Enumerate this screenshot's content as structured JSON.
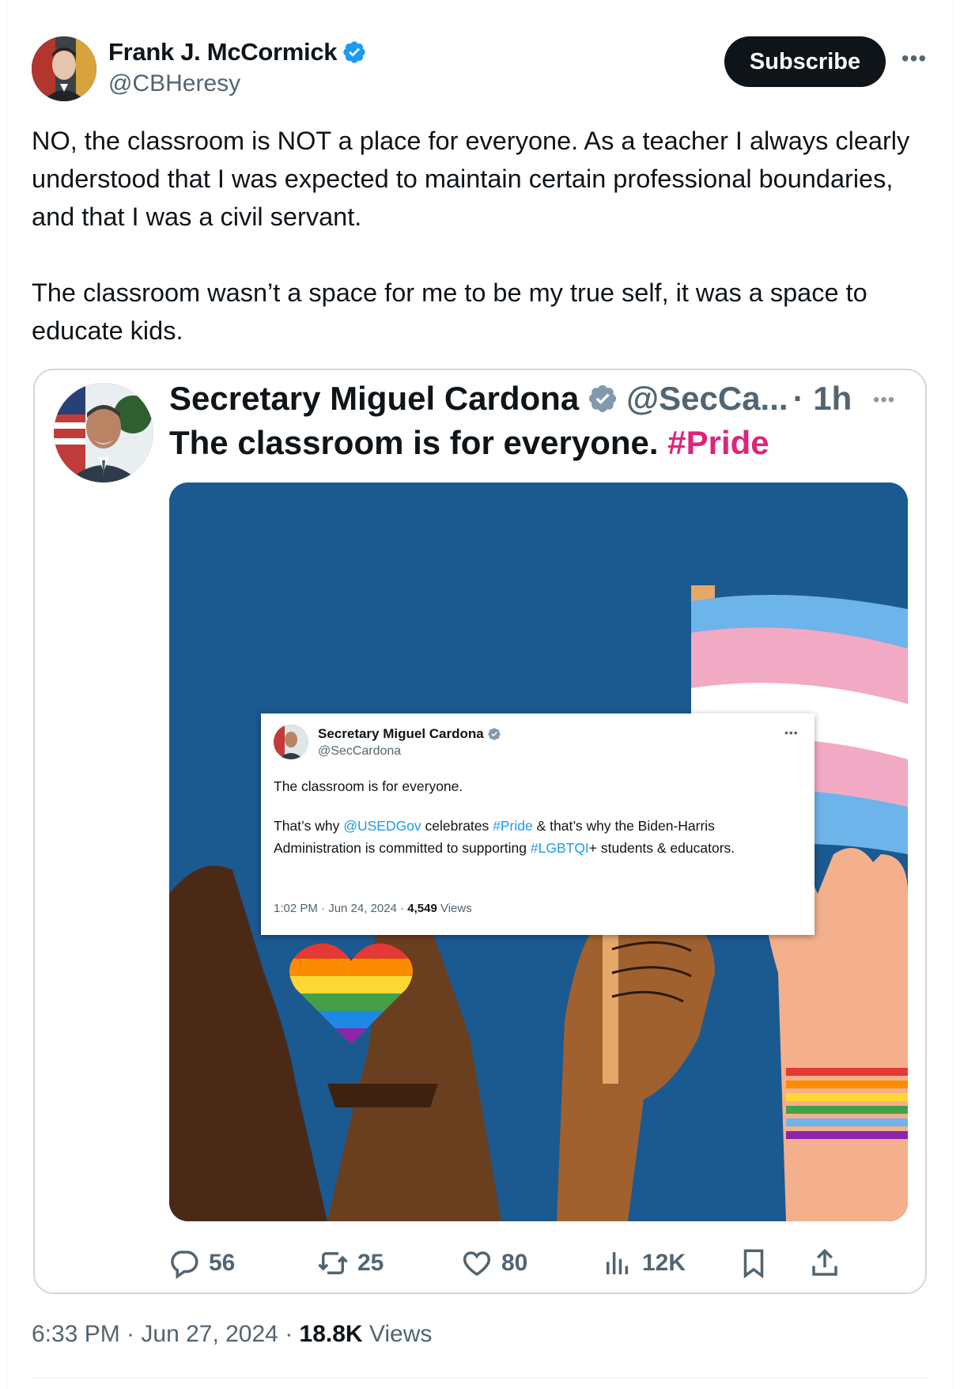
{
  "author": {
    "name": "Frank J. McCormick",
    "handle": "@CBHeresy",
    "verified": true
  },
  "subscribe_label": "Subscribe",
  "tweet": {
    "paragraph1": "NO, the classroom is NOT a place for everyone. As a teacher I always clearly understood that I was expected to maintain certain professional boundaries, and that I was a civil servant.",
    "paragraph2": "The classroom wasn’t a space for me to be my true self, it was a space to educate kids."
  },
  "quote": {
    "name": "Secretary Miguel Cardona",
    "handle": "@SecCa...",
    "time": "· 1h",
    "text": "The classroom is for everyone.",
    "hashtag": "#Pride",
    "embed": {
      "name": "Secretary Miguel Cardona",
      "handle": "@SecCardona",
      "line1": "The classroom is for everyone.",
      "line2_a": "That’s why ",
      "line2_link1": "@USEDGov",
      "line2_b": " celebrates ",
      "line2_link2": "#Pride",
      "line2_c": " & that’s why the Biden-Harris Administration is committed to supporting ",
      "line2_link3": "#LGBTQI",
      "line2_d": "+ students & educators.",
      "meta_time": "1:02 PM · Jun 24, 2024 · ",
      "meta_views_count": "4,549",
      "meta_views_label": " Views"
    }
  },
  "actions": {
    "replies": "56",
    "reposts": "25",
    "likes": "80",
    "views": "12K"
  },
  "footer": {
    "timestamp": "6:33 PM · Jun 27, 2024 · ",
    "views_count": "18.8K",
    "views_label": " Views"
  },
  "colors": {
    "verified": "#1d9bf0",
    "pride_pink": "#e0237a",
    "image_bg": "#1d5c95"
  }
}
